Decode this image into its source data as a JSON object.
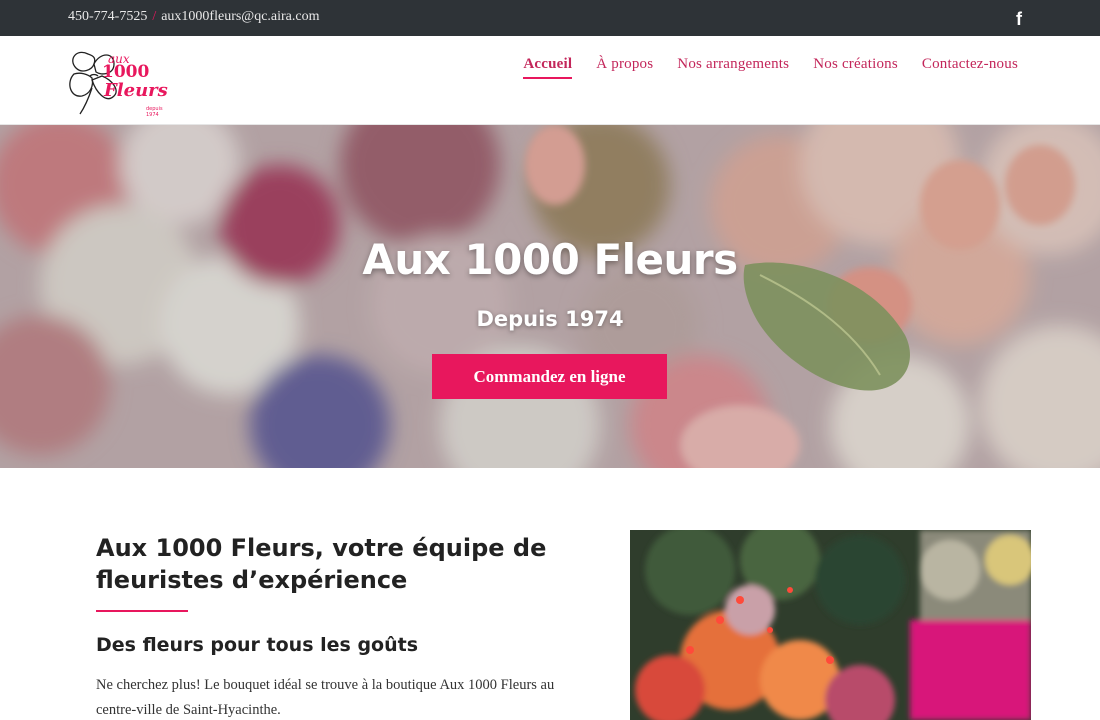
{
  "topbar": {
    "phone": "450-774-7525",
    "separator": "/",
    "email": "aux1000fleurs@qc.aira.com",
    "social_icon": "facebook-icon"
  },
  "logo": {
    "line1": "aux",
    "line2": "1000",
    "line3": "Fleurs",
    "tagline": "depuis 1974"
  },
  "nav": {
    "items": [
      {
        "label": "Accueil",
        "active": true
      },
      {
        "label": "À propos"
      },
      {
        "label": "Nos arrangements"
      },
      {
        "label": "Nos créations"
      },
      {
        "label": "Contactez-nous"
      }
    ]
  },
  "hero": {
    "title": "Aux 1000 Fleurs",
    "subtitle": "Depuis 1974",
    "cta_label": "Commandez en ligne"
  },
  "content": {
    "title": "Aux 1000 Fleurs, votre équipe de fleuristes d’expérience",
    "subtitle": "Des fleurs pour tous les goûts",
    "body": "Ne cherchez plus! Le bouquet idéal se trouve à la boutique Aux 1000 Fleurs au centre-ville de Saint-Hyacinthe."
  },
  "colors": {
    "accent": "#e8175d",
    "topbar_bg": "#2e3337",
    "nav_text": "#c3265a"
  }
}
